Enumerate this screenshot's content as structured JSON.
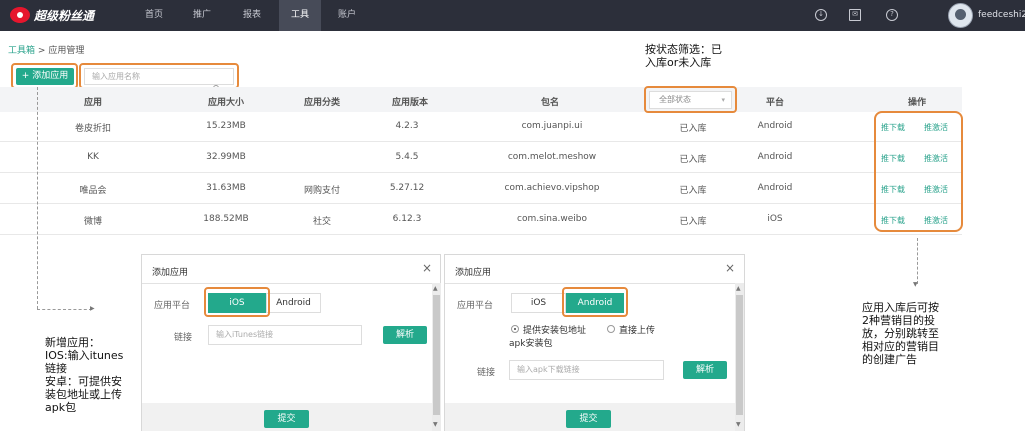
{
  "app": {
    "brand": "超级粉丝通"
  },
  "nav": {
    "items": [
      "首页",
      "推广",
      "报表",
      "工具",
      "账户"
    ],
    "active": "工具"
  },
  "header": {
    "icons": [
      "download-icon",
      "mail-icon",
      "help-icon"
    ],
    "username": "feedceshi2"
  },
  "breadcrumb": {
    "root": "工具箱",
    "separator": ">",
    "current": "应用管理"
  },
  "toolbar": {
    "add_label": "+ 添加应用",
    "search_placeholder": "输入应用名称"
  },
  "table": {
    "headers": [
      "应用",
      "应用大小",
      "应用分类",
      "应用版本",
      "包名",
      "全部状态",
      "平台",
      "操作"
    ],
    "status_filter": "全部状态",
    "rows": [
      {
        "name": "卷皮折扣",
        "size": "15.23MB",
        "category": "",
        "version": "4.2.3",
        "package": "com.juanpi.ui",
        "status": "已入库",
        "platform": "Android",
        "op1": "推下载",
        "op2": "推激活"
      },
      {
        "name": "KK",
        "size": "32.99MB",
        "category": "",
        "version": "5.4.5",
        "package": "com.melot.meshow",
        "status": "已入库",
        "platform": "Android",
        "op1": "推下载",
        "op2": "推激活"
      },
      {
        "name": "唯品会",
        "size": "31.63MB",
        "category": "网购支付",
        "version": "5.27.12",
        "package": "com.achievo.vipshop",
        "status": "已入库",
        "platform": "Android",
        "op1": "推下载",
        "op2": "推激活"
      },
      {
        "name": "微博",
        "size": "188.52MB",
        "category": "社交",
        "version": "6.12.3",
        "package": "com.sina.weibo",
        "status": "已入库",
        "platform": "iOS",
        "op1": "推下载",
        "op2": "推激活"
      }
    ]
  },
  "dialog_ios": {
    "title": "添加应用",
    "platform_label": "应用平台",
    "platforms": [
      "iOS",
      "Android"
    ],
    "selected": "iOS",
    "link_label": "链接",
    "link_placeholder": "输入iTunes链接",
    "parse_button": "解析",
    "submit_button": "提交"
  },
  "dialog_android": {
    "title": "添加应用",
    "platform_label": "应用平台",
    "platforms": [
      "iOS",
      "Android"
    ],
    "selected": "Android",
    "radio_options": [
      "提供安装包地址",
      "直接上传"
    ],
    "radio_option_suffix": "apk安装包",
    "link_label": "链接",
    "link_placeholder": "输入apk下载链接",
    "parse_button": "解析",
    "submit_button": "提交"
  },
  "annotations": {
    "filter_note": [
      "按状态筛选：已",
      "入库or未入库"
    ],
    "add_note": [
      "新增应用：",
      "IOS:输入itunes",
      "链接",
      "安卓：可提供安",
      "装包地址或上传",
      "apk包"
    ],
    "ops_note": [
      "应用入库后可按",
      "2种营销目的投",
      "放，分别跳转至",
      "相对应的营销目",
      "的创建广告"
    ]
  },
  "colors": {
    "brand_green": "#23a98c",
    "highlight_orange": "#e68a3c",
    "topbar": "#2c2f3a"
  }
}
